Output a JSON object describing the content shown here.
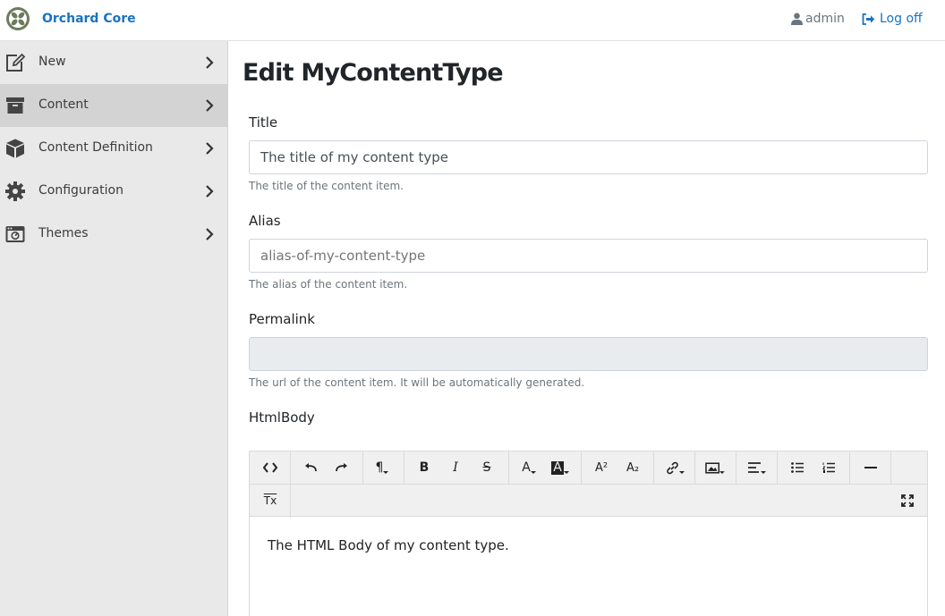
{
  "brand": {
    "name": "Orchard Core",
    "logo_icon": "orchard-logo-icon"
  },
  "header": {
    "user_label": "admin",
    "user_icon": "user-icon",
    "logoff_label": "Log off",
    "logoff_icon": "sign-out-icon"
  },
  "sidebar": {
    "items": [
      {
        "label": "New",
        "icon": "edit-icon",
        "active": false
      },
      {
        "label": "Content",
        "icon": "archive-icon",
        "active": true
      },
      {
        "label": "Content Definition",
        "icon": "cube-icon",
        "active": false
      },
      {
        "label": "Configuration",
        "icon": "gear-icon",
        "active": false
      },
      {
        "label": "Themes",
        "icon": "theme-icon",
        "active": false
      }
    ]
  },
  "main": {
    "title": "Edit MyContentType",
    "fields": {
      "title": {
        "label": "Title",
        "value": "The title of my content type",
        "hint": "The title of the content item."
      },
      "alias": {
        "label": "Alias",
        "placeholder": "alias-of-my-content-type",
        "hint": "The alias of the content item."
      },
      "permalink": {
        "label": "Permalink",
        "value": "",
        "hint": "The url of the content item. It will be automatically generated."
      },
      "htmlbody": {
        "label": "HtmlBody",
        "content": "The HTML Body of my content type."
      }
    },
    "toolbar": {
      "paragraph": "¶",
      "bold": "B",
      "italic": "I",
      "strike": "S",
      "forecolor": "A",
      "backcolor": "A",
      "superscript": "A²",
      "subscript": "A₂",
      "clear_format": "Tx"
    }
  },
  "colors": {
    "accent": "#1a73c0",
    "sidebar_bg": "#e9e9e9",
    "sidebar_active": "#d3d3d3",
    "readonly_bg": "#e9ecef"
  }
}
